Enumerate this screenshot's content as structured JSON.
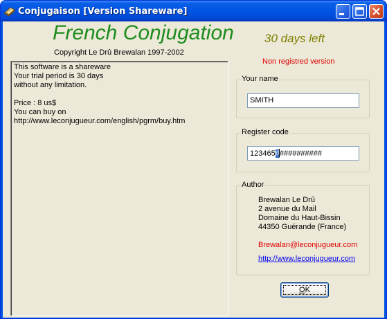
{
  "window": {
    "title": "Conjugaison [Version Shareware]"
  },
  "header": {
    "app_title": "French Conjugation",
    "days_left": "30 days left",
    "copyright": "Copyright Le Drû Brewalan 1997-2002",
    "registration_status": "Non registred version"
  },
  "info_text": {
    "lines": [
      "This software is a shareware",
      "Your trial period is 30 days",
      "without any limitation.",
      "",
      "Price : 8 us$",
      "You can buy on",
      "http://www.leconjugueur.com/english/pgrm/buy.htm"
    ]
  },
  "name_group": {
    "title": "Your name",
    "value": "SMITH"
  },
  "register_group": {
    "title": "Register code",
    "value_before": "123465",
    "value_selected": "#",
    "value_after": "##########"
  },
  "author_group": {
    "title": "Author",
    "name": "Brewalan Le Drû",
    "address1": "2 avenue du Mail",
    "address2": "Domaine du Haut-Bissin",
    "address3": "44350 Guérande (France)",
    "email": "Brewalan@leconjugueur.com",
    "website": "http://www.leconjugueur.com"
  },
  "ok_button": {
    "underlined": "O",
    "rest": "K"
  },
  "colors": {
    "heading_green": "#1e8c1e",
    "days_left_olive": "#808000",
    "nonreg_red": "#e00000",
    "link_blue": "#0000ee",
    "titlebar_blue": "#0054e3"
  }
}
